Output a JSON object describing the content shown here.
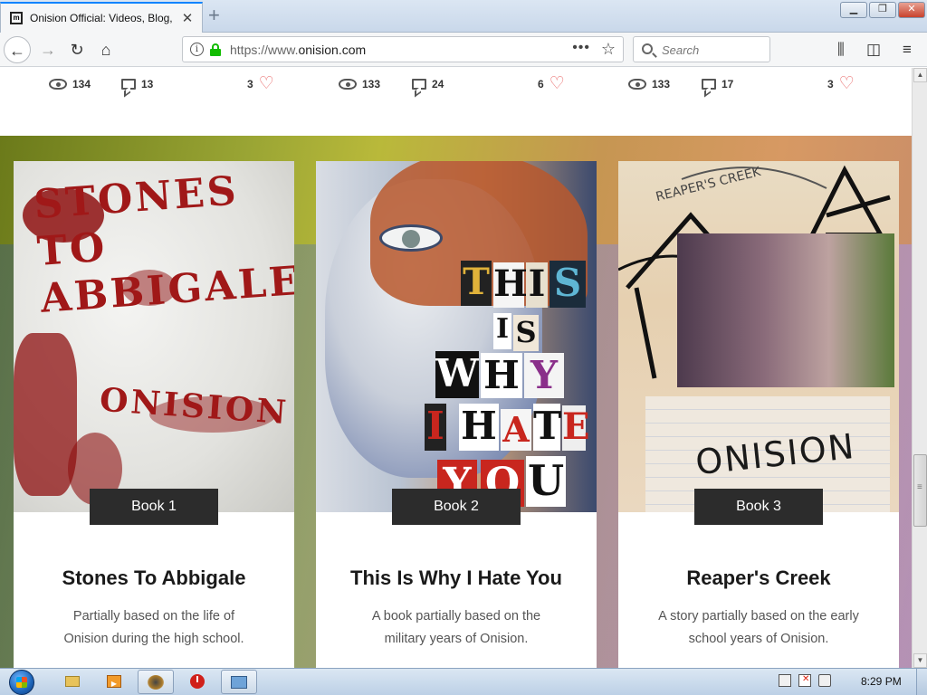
{
  "browser": {
    "tab_title": "Onision Official: Videos, Blog, F",
    "url_protocol": "https://www.",
    "url_domain": "onision.com",
    "search_placeholder": "Search"
  },
  "stats": [
    {
      "views": "134",
      "comments": "13",
      "likes": "3"
    },
    {
      "views": "133",
      "comments": "24",
      "likes": "6"
    },
    {
      "views": "133",
      "comments": "17",
      "likes": "3"
    }
  ],
  "books": [
    {
      "badge": "Book 1",
      "title": "Stones To Abbigale",
      "description": "Partially based on the life of Onision during the high school.",
      "cover_text_top": "STONES TO ABBIGALE",
      "cover_text_bottom": "ONISION"
    },
    {
      "badge": "Book 2",
      "title": "This Is Why I Hate You",
      "description": "A book partially based on the military years of Onision.",
      "cover_letters": [
        "T",
        "H",
        "I",
        "S",
        "I",
        "S",
        "W",
        "H",
        "Y",
        "I",
        "H",
        "A",
        "T",
        "E",
        "Y",
        "O",
        "U"
      ]
    },
    {
      "badge": "Book 3",
      "title": "Reaper's Creek",
      "description": "A story partially based on the early school years of Onision.",
      "cover_text_top": "REAPER'S CREEK",
      "cover_text_bottom": "ONISION"
    }
  ],
  "taskbar": {
    "clock": "8:29 PM"
  },
  "colors": {
    "heart": "#e86767",
    "book_badge": "#2c2c2c",
    "secure_lock": "#12bc00",
    "tab_accent": "#0a84ff"
  }
}
